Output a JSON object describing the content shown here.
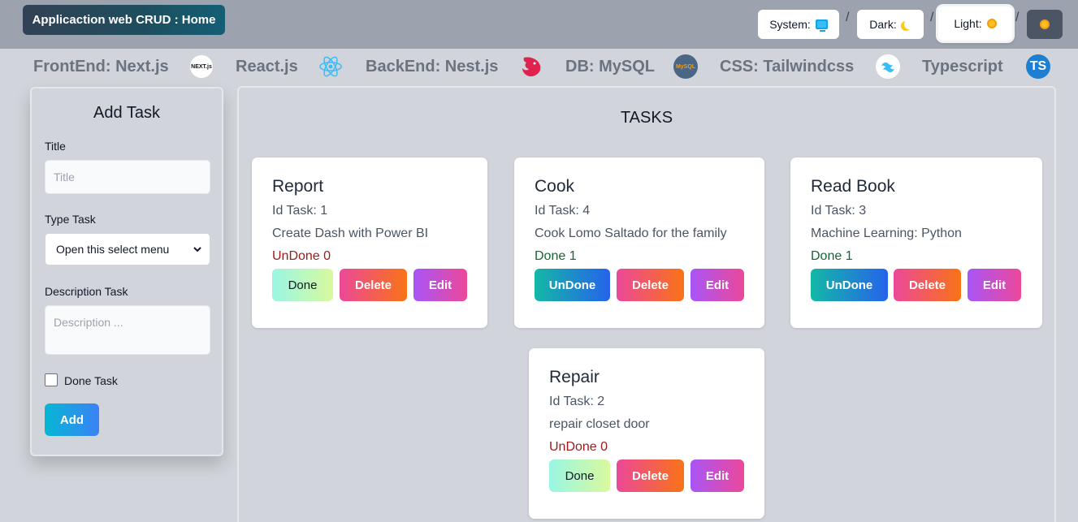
{
  "header": {
    "app_title": "Applicaction web CRUD : Home",
    "theme": {
      "system_label": "System:",
      "dark_label": "Dark:",
      "light_label": "Light:",
      "separator": "/"
    }
  },
  "tech_bar": [
    {
      "label": "FrontEnd: Next.js",
      "icon": "nextjs-icon",
      "icon_text": "NEXT.js"
    },
    {
      "label": "React.js",
      "icon": "react-icon"
    },
    {
      "label": "BackEnd: Nest.js",
      "icon": "nestjs-icon"
    },
    {
      "label": "DB: MySQL",
      "icon": "mysql-icon",
      "icon_text": "MySQL"
    },
    {
      "label": "CSS: Tailwindcss",
      "icon": "tailwind-icon"
    },
    {
      "label": "Typescript",
      "icon": "typescript-icon",
      "icon_text": "TS"
    }
  ],
  "add_task": {
    "heading": "Add Task",
    "title_label": "Title",
    "title_placeholder": "Title",
    "type_label": "Type Task",
    "type_selected": "Open this select menu",
    "description_label": "Description Task",
    "description_placeholder": "Description ...",
    "done_label": "Done Task",
    "done_checked": false,
    "add_button": "Add"
  },
  "tasks": {
    "heading": "TASKS",
    "items": [
      {
        "title": "Report",
        "id_text": "Id Task: 1",
        "description": "Create Dash with Power BI",
        "status": "UnDone 0",
        "toggle_label": "Done",
        "delete_label": "Delete",
        "edit_label": "Edit"
      },
      {
        "title": "Cook",
        "id_text": "Id Task: 4",
        "description": "Cook Lomo Saltado for the family",
        "status": "Done 1",
        "toggle_label": "UnDone",
        "delete_label": "Delete",
        "edit_label": "Edit"
      },
      {
        "title": "Read Book",
        "id_text": "Id Task: 3",
        "description": "Machine Learning: Python",
        "status": "Done 1",
        "toggle_label": "UnDone",
        "delete_label": "Delete",
        "edit_label": "Edit"
      },
      {
        "title": "Repair",
        "id_text": "Id Task: 2",
        "description": "repair closet door",
        "status": "UnDone 0",
        "toggle_label": "Done",
        "delete_label": "Delete",
        "edit_label": "Edit"
      }
    ]
  },
  "colors": {
    "undone_text": "#991b1b",
    "done_text": "#166534",
    "header_bg": "#9ca3af",
    "page_bg": "#d1d5db"
  }
}
